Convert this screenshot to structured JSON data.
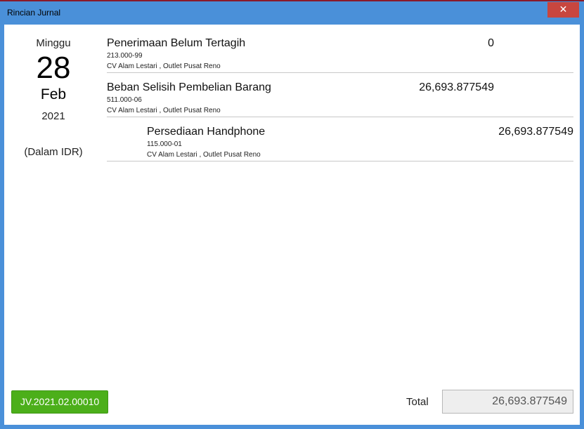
{
  "window": {
    "title": "Rincian Jurnal",
    "close_glyph": "✕"
  },
  "date": {
    "day_name": "Minggu",
    "day": "28",
    "month": "Feb",
    "year": "2021",
    "currency": "(Dalam IDR)"
  },
  "entries": [
    {
      "type": "debit",
      "name": "Penerimaan Belum Tertagih",
      "code": "213.000-99",
      "location": "CV Alam Lestari , Outlet Pusat Reno",
      "amount": "0"
    },
    {
      "type": "debit",
      "name": "Beban Selisih Pembelian Barang",
      "code": "511.000-06",
      "location": "CV Alam Lestari , Outlet Pusat Reno",
      "amount": "26,693.877549"
    },
    {
      "type": "credit",
      "name": "Persediaan Handphone",
      "code": "115.000-01",
      "location": "CV Alam Lestari , Outlet Pusat Reno",
      "amount": "26,693.877549"
    }
  ],
  "footer": {
    "journal_number": "JV.2021.02.00010",
    "total_label": "Total",
    "total_value": "26,693.877549"
  },
  "colors": {
    "titlebar": "#4a90d9",
    "close": "#c8463f",
    "jv_button": "#4caf1a"
  }
}
